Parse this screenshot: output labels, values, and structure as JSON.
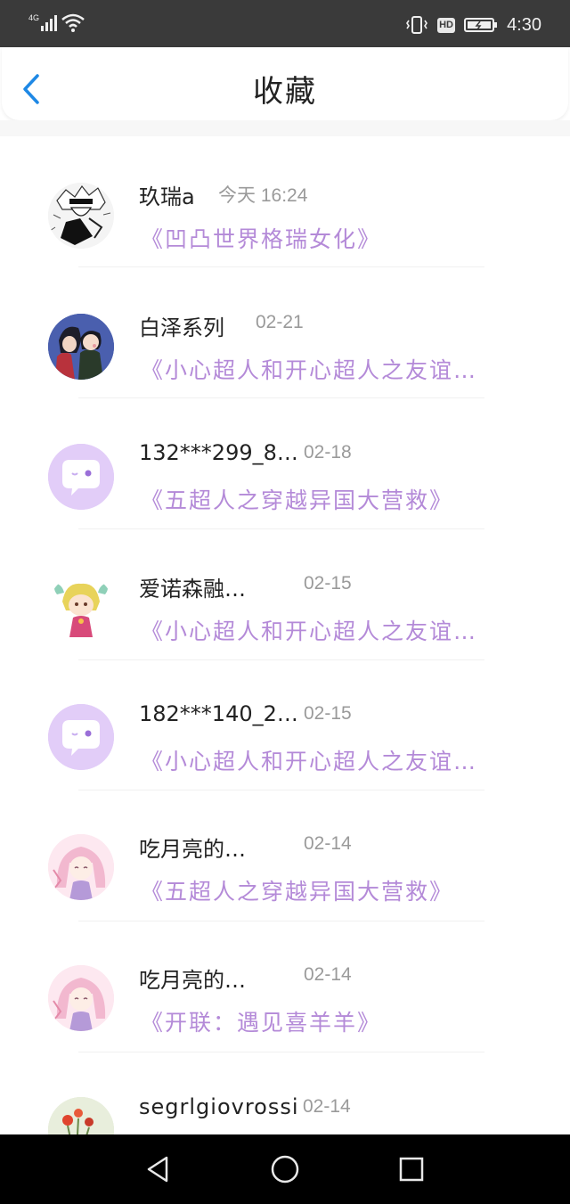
{
  "status_bar": {
    "signal": "4G",
    "time": "4:30",
    "hd": "HD"
  },
  "header": {
    "title": "收藏"
  },
  "items": [
    {
      "name": "玖瑞a",
      "date": "今天 16:24",
      "book": "《凹凸世界格瑞女化》",
      "avatar": "manga-character-avatar"
    },
    {
      "name": "白泽系列",
      "date": "02-21",
      "book": "《小心超人和开心超人之友谊…",
      "avatar": "anime-couple-avatar"
    },
    {
      "name": "132***299_8…",
      "date": "02-18",
      "book": "《五超人之穿越异国大营救》",
      "avatar": "default-chat-avatar"
    },
    {
      "name": "爱诺森融…",
      "date": "02-15",
      "book": "《小心超人和开心超人之友谊…",
      "avatar": "chibi-character-avatar"
    },
    {
      "name": "182***140_2…",
      "date": "02-15",
      "book": "《小心超人和开心超人之友谊…",
      "avatar": "default-chat-avatar"
    },
    {
      "name": "吃月亮的…",
      "date": "02-14",
      "book": "《五超人之穿越异国大营救》",
      "avatar": "pink-anime-avatar"
    },
    {
      "name": "吃月亮的…",
      "date": "02-14",
      "book": "《开联：遇见喜羊羊》",
      "avatar": "pink-anime-avatar"
    },
    {
      "name": "segrlgiovrossi",
      "date": "02-14",
      "book": "",
      "avatar": "flower-avatar"
    }
  ],
  "colors": {
    "accent_blue": "#1e88e5",
    "book_purple": "#b48ad8",
    "avatar_lavender": "#e2cdf8"
  }
}
